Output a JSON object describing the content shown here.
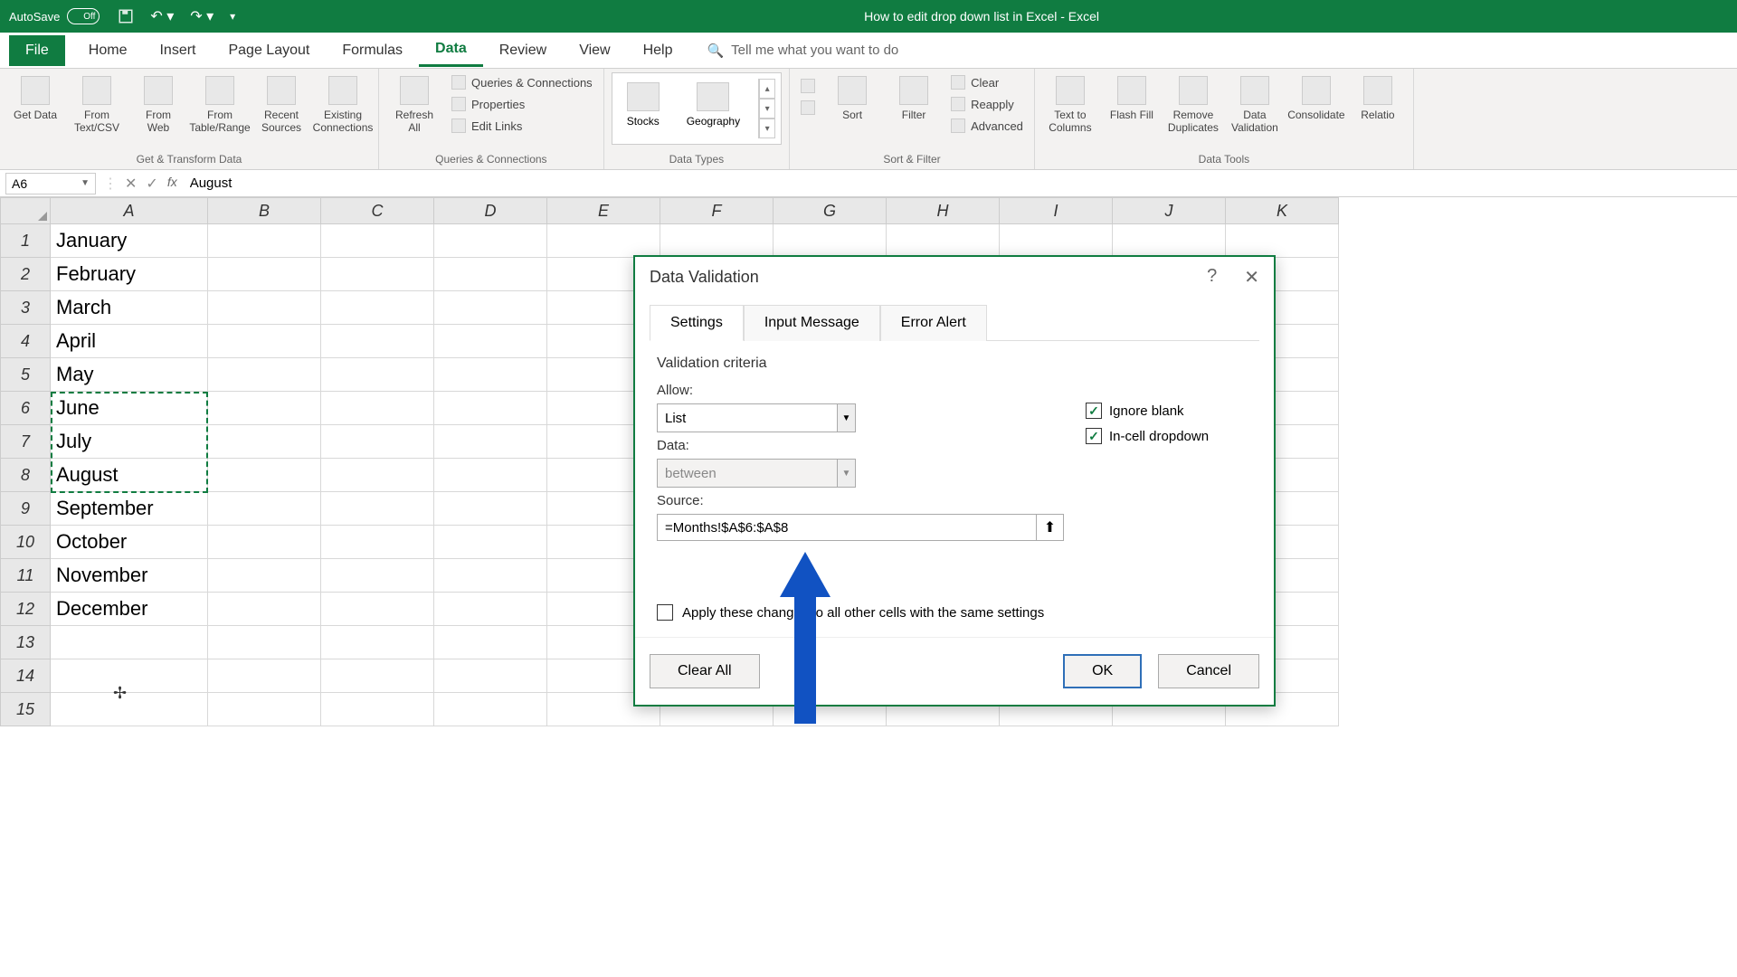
{
  "titlebar": {
    "autosave_label": "AutoSave",
    "autosave_state": "Off",
    "title": "How to edit drop down list in Excel  -  Excel"
  },
  "menu": {
    "file": "File",
    "home": "Home",
    "insert": "Insert",
    "pagelayout": "Page Layout",
    "formulas": "Formulas",
    "data": "Data",
    "review": "Review",
    "view": "View",
    "help": "Help",
    "tellme": "Tell me what you want to do"
  },
  "ribbon": {
    "group1": "Get & Transform Data",
    "group2": "Queries & Connections",
    "group3": "Data Types",
    "group4": "Sort & Filter",
    "group5": "Data Tools",
    "getdata": "Get Data",
    "fromcsv": "From Text/CSV",
    "fromweb": "From Web",
    "fromtable": "From Table/Range",
    "recent": "Recent Sources",
    "existing": "Existing Connections",
    "refresh": "Refresh All",
    "queries": "Queries & Connections",
    "properties": "Properties",
    "editlinks": "Edit Links",
    "stocks": "Stocks",
    "geography": "Geography",
    "sort": "Sort",
    "filter": "Filter",
    "clear": "Clear",
    "reapply": "Reapply",
    "advanced": "Advanced",
    "texttocols": "Text to Columns",
    "flashfill": "Flash Fill",
    "removedup": "Remove Duplicates",
    "datavalidation": "Data Validation",
    "consolidate": "Consolidate",
    "relations": "Relatio"
  },
  "fbar": {
    "namebox": "A6",
    "formula": "August"
  },
  "columns": [
    "A",
    "B",
    "C",
    "D",
    "E",
    "F",
    "G",
    "H",
    "I",
    "J",
    "K"
  ],
  "cells": {
    "r1": "January",
    "r2": "February",
    "r3": "March",
    "r4": "April",
    "r5": "May",
    "r6": "June",
    "r7": "July",
    "r8": "August",
    "r9": "September",
    "r10": "October",
    "r11": "November",
    "r12": "December"
  },
  "dialog": {
    "title": "Data Validation",
    "tab1": "Settings",
    "tab2": "Input Message",
    "tab3": "Error Alert",
    "section": "Validation criteria",
    "allow_label": "Allow:",
    "allow_value": "List",
    "data_label": "Data:",
    "data_value": "between",
    "source_label": "Source:",
    "source_value": "=Months!$A$6:$A$8",
    "ignore_blank": "Ignore blank",
    "incell": "In-cell dropdown",
    "apply": "Apply these changes to all other cells with the same settings",
    "clearall": "Clear All",
    "ok": "OK",
    "cancel": "Cancel"
  }
}
